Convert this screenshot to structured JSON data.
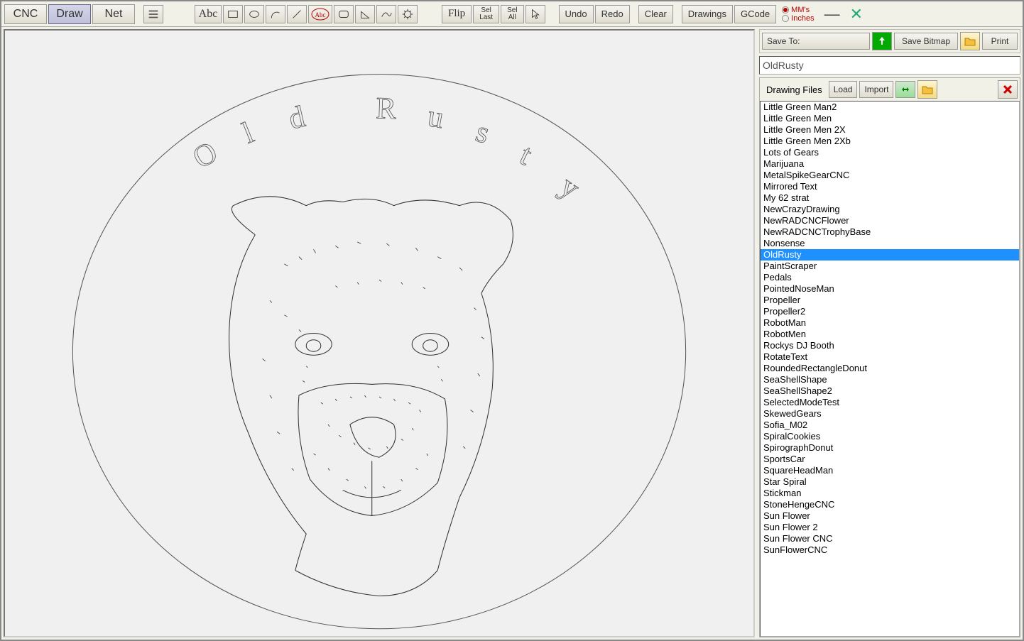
{
  "modes": {
    "cnc": "CNC",
    "draw": "Draw",
    "net": "Net"
  },
  "tools": {
    "abc": "Abc",
    "abc_circle": "Abc",
    "flip": "Flip",
    "sel_last": "Sel\nLast",
    "sel_all": "Sel\nAll",
    "undo": "Undo",
    "redo": "Redo",
    "clear": "Clear",
    "drawings": "Drawings",
    "gcode": "GCode"
  },
  "units": {
    "mm": "MM's",
    "inches": "Inches",
    "selected": "mm"
  },
  "side": {
    "save_to": "Save To:",
    "save_bitmap": "Save Bitmap",
    "print": "Print",
    "filename": "OldRusty",
    "drawing_files": "Drawing Files",
    "load": "Load",
    "import": "Import"
  },
  "canvas": {
    "title_text": "Old Rusty"
  },
  "files": [
    "Little Green Man2",
    "Little Green Men",
    "Little Green Men 2X",
    "Little Green Men 2Xb",
    "Lots of Gears",
    "Marijuana",
    "MetalSpikeGearCNC",
    "Mirrored Text",
    "My 62 strat",
    "NewCrazyDrawing",
    "NewRADCNCFlower",
    "NewRADCNCTrophyBase",
    "Nonsense",
    "OldRusty",
    "PaintScraper",
    "Pedals",
    "PointedNoseMan",
    "Propeller",
    "Propeller2",
    "RobotMan",
    "RobotMen",
    "Rockys DJ Booth",
    "RotateText",
    "RoundedRectangleDonut",
    "SeaShellShape",
    "SeaShellShape2",
    "SelectedModeTest",
    "SkewedGears",
    "Sofia_M02",
    "SpiralCookies",
    "SpirographDonut",
    "SportsCar",
    "SquareHeadMan",
    "Star Spiral",
    "Stickman",
    "StoneHengeCNC",
    "Sun Flower",
    "Sun Flower 2",
    "Sun Flower CNC",
    "SunFlowerCNC"
  ],
  "selected_file": "OldRusty"
}
